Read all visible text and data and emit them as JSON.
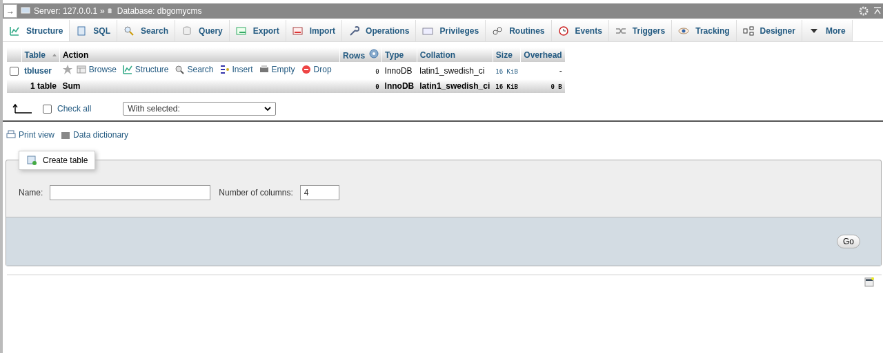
{
  "breadcrumb": {
    "toggle": "→",
    "server": "Server: 127.0.0.1",
    "separator": "»",
    "database": "Database: dbgomycms"
  },
  "tabs": [
    {
      "label": "Structure",
      "selected": true
    },
    {
      "label": "SQL",
      "selected": false
    },
    {
      "label": "Search",
      "selected": false
    },
    {
      "label": "Query",
      "selected": false
    },
    {
      "label": "Export",
      "selected": false
    },
    {
      "label": "Import",
      "selected": false
    },
    {
      "label": "Operations",
      "selected": false
    },
    {
      "label": "Privileges",
      "selected": false
    },
    {
      "label": "Routines",
      "selected": false
    },
    {
      "label": "Events",
      "selected": false
    },
    {
      "label": "Triggers",
      "selected": false
    },
    {
      "label": "Tracking",
      "selected": false
    },
    {
      "label": "Designer",
      "selected": false
    },
    {
      "label": "More",
      "selected": false
    }
  ],
  "table": {
    "columns": [
      "Table",
      "Action",
      "Rows",
      "Type",
      "Collation",
      "Size",
      "Overhead"
    ],
    "rows": [
      {
        "checked": false,
        "name": "tbluser",
        "actions": [
          "Browse",
          "Structure",
          "Search",
          "Insert",
          "Empty",
          "Drop"
        ],
        "rows": "0",
        "type": "InnoDB",
        "collation": "latin1_swedish_ci",
        "size": "16 KiB",
        "overhead": "-"
      }
    ],
    "footer": {
      "name": "1 table",
      "action": "Sum",
      "rows": "0",
      "type": "InnoDB",
      "collation": "latin1_swedish_ci",
      "size": "16 KiB",
      "overhead": "0 B"
    }
  },
  "check_all": {
    "label": "Check all",
    "checked": false
  },
  "with_selected": "With selected:",
  "links": [
    "Print view",
    "Data dictionary"
  ],
  "create_table": {
    "legend": "Create table",
    "name_label": "Name:",
    "columns_label": "Number of columns:",
    "columns_value": "4",
    "button": "Go"
  }
}
